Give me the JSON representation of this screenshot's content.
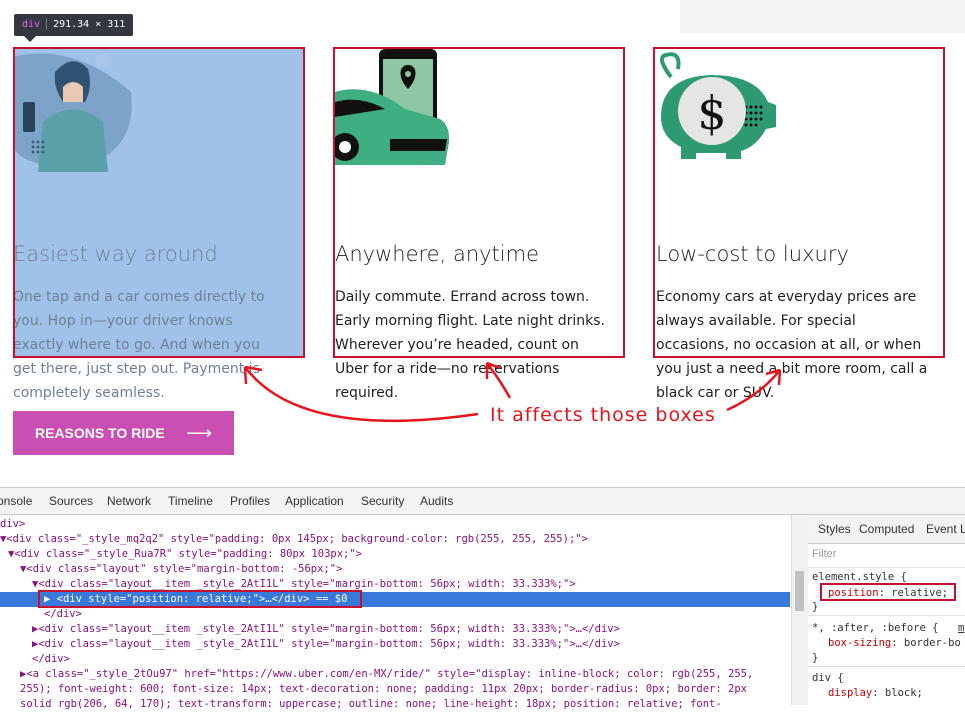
{
  "tooltip": {
    "tag": "div",
    "size": "291.34 × 311"
  },
  "cards": [
    {
      "title": "Easiest way around",
      "text": "One tap and a car comes directly to you. Hop in—your driver knows exactly where to go. And when you get there, just step out. Payment is completely seamless."
    },
    {
      "title": "Anywhere, anytime",
      "text": "Daily commute. Errand across town. Early morning flight. Late night drinks. Wherever you’re headed, count on Uber for a ride—no reservations required."
    },
    {
      "title": "Low-cost to luxury",
      "text": "Economy cars at everyday prices are always available. For special occasions, no occasion at all, or when you just a need a bit more room, call a black car or SUV."
    }
  ],
  "annotation": "It affects those boxes",
  "cta": {
    "label": "REASONS TO RIDE",
    "arrow": "⟶"
  },
  "devtools": {
    "tabs": [
      "onsole",
      "Sources",
      "Network",
      "Timeline",
      "Profiles",
      "Application",
      "Security",
      "Audits"
    ],
    "styles_tabs": [
      "Styles",
      "Computed",
      "Event L"
    ],
    "filter_placeholder": "Filter",
    "element_style_selector": "element.style {",
    "element_style_prop": "position",
    "element_style_value": "relative;",
    "rule2_selector": "*, :after, :before {",
    "rule2_source": "m",
    "rule2_prop": "box-sizing",
    "rule2_value": "border-bo",
    "rule3_selector": "div {",
    "rule3_prop": "display",
    "rule3_value": "block;",
    "close_brace": "}",
    "dom_lines": [
      {
        "text": "div>"
      },
      {
        "text": "▼<div class=\"_style_mq2q2\" style=\"padding: 0px 145px; background-color: rgb(255, 255, 255);\">"
      },
      {
        "text": "▼<div class=\"_style_Rua7R\" style=\"padding: 80px 103px;\">"
      },
      {
        "text": "▼<div class=\"layout\" style=\"margin-bottom: -56px;\">"
      },
      {
        "text": "▼<div class=\"layout__item _style_2AtI1L\" style=\"margin-bottom: 56px; width: 33.333%;\">"
      },
      {
        "text": "▶ <div style=\"position: relative;\">…</div> == $0"
      },
      {
        "text": "</div>"
      },
      {
        "text": "▶<div class=\"layout__item _style_2AtI1L\" style=\"margin-bottom: 56px; width: 33.333%;\">…</div>"
      },
      {
        "text": "▶<div class=\"layout__item _style_2AtI1L\" style=\"margin-bottom: 56px; width: 33.333%;\">…</div>"
      },
      {
        "text": "</div>"
      },
      {
        "text": "▶<a class=\"_style_2tOu97\" href=\"https://www.uber.com/en-MX/ride/\" style=\"display: inline-block; color: rgb(255, 255,"
      },
      {
        "text": "255); font-weight: 600; font-size: 14px; text-decoration: none; padding: 11px 20px; border-radius: 0px; border: 2px"
      },
      {
        "text": "solid rgb(206, 64, 170); text-transform: uppercase; outline: none; line-height: 18px; position: relative; font-"
      }
    ]
  }
}
